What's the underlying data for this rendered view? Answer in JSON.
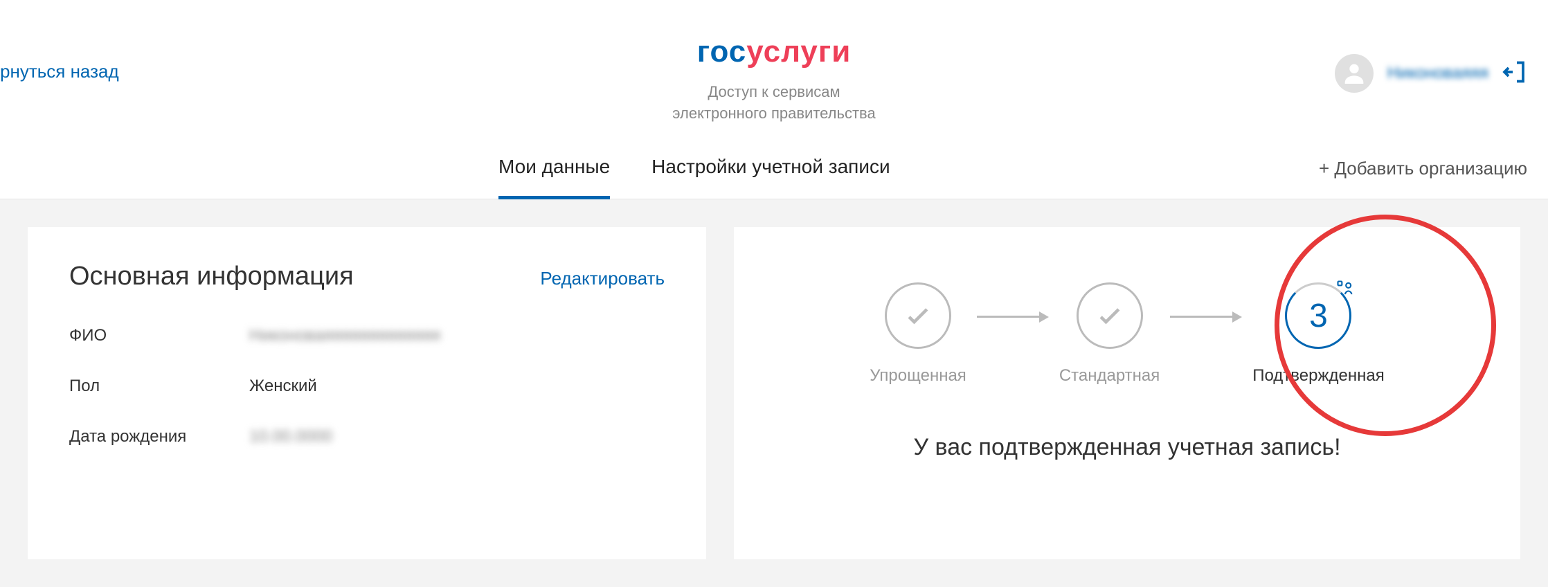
{
  "header": {
    "back_label": "рнуться назад",
    "logo_part1": "гос",
    "logo_part2": "услуги",
    "tagline_line1": "Доступ к сервисам",
    "tagline_line2": "электронного правительства",
    "username_masked": "Никоноваяяя"
  },
  "tabs": {
    "my_data": "Мои данные",
    "account_settings": "Настройки учетной записи",
    "add_org": "+ Добавить организацию"
  },
  "main_info": {
    "title": "Основная информация",
    "edit_label": "Редактировать",
    "fio_label": "ФИО",
    "fio_value_masked": "Никоноваяяяяяяяяяяяяя",
    "gender_label": "Пол",
    "gender_value": "Женский",
    "dob_label": "Дата рождения",
    "dob_value_masked": "10.00.0000"
  },
  "steps": {
    "step1_label": "Упрощенная",
    "step2_label": "Стандартная",
    "step3_label": "Подтвержденная",
    "step3_number": "3",
    "confirmed_message": "У вас подтвержденная учетная запись!"
  }
}
